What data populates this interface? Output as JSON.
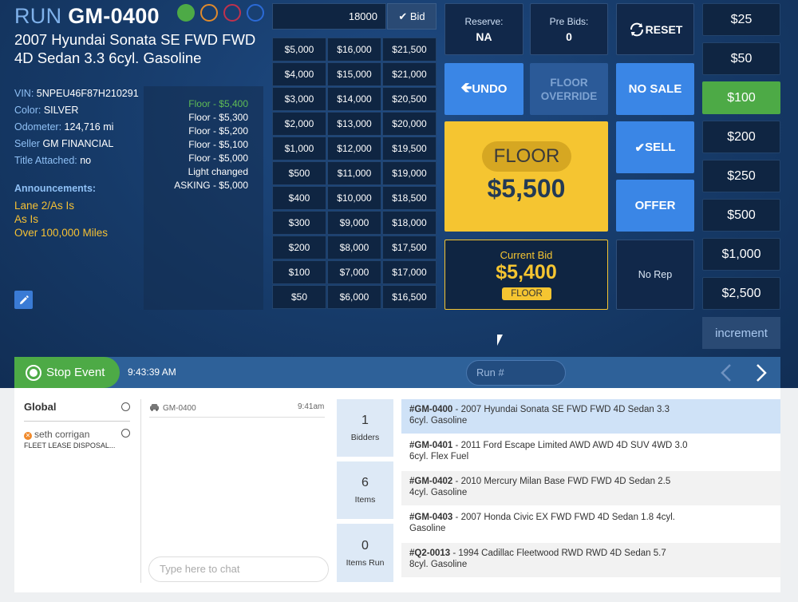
{
  "header": {
    "run_prefix": "RUN",
    "run_number": "GM-0400",
    "status_circles": [
      "#4daa46",
      "#e08a2c",
      "#c0314d",
      "#2b6ad6"
    ],
    "vehicle_title": "2007 Hyundai Sonata SE FWD FWD 4D Sedan 3.3 6cyl. Gasoline"
  },
  "vehicle_info": {
    "vin_label": "VIN:",
    "vin": "5NPEU46F87H210291",
    "color_label": "Color:",
    "color": "SILVER",
    "odometer_label": "Odometer:",
    "odometer": "124,716 mi",
    "seller_label": "Seller",
    "seller": "GM FINANCIAL",
    "title_label": "Title Attached:",
    "title": "no"
  },
  "announcements": {
    "heading": "Announcements:",
    "items": [
      "Lane 2/As Is",
      "As Is",
      "Over 100,000 Miles"
    ]
  },
  "bid_log": [
    "Floor - $5,400",
    "Floor - $5,300",
    "Floor - $5,200",
    "Floor - $5,100",
    "Floor - $5,000",
    "Light changed",
    "ASKING - $5,000"
  ],
  "bid_entry": {
    "value": "18000",
    "button": "Bid"
  },
  "amounts": [
    "$5,000",
    "$16,000",
    "$21,500",
    "$4,000",
    "$15,000",
    "$21,000",
    "$3,000",
    "$14,000",
    "$20,500",
    "$2,000",
    "$13,000",
    "$20,000",
    "$1,000",
    "$12,000",
    "$19,500",
    "$500",
    "$11,000",
    "$19,000",
    "$400",
    "$10,000",
    "$18,500",
    "$300",
    "$9,000",
    "$18,000",
    "$200",
    "$8,000",
    "$17,500",
    "$100",
    "$7,000",
    "$17,000",
    "$50",
    "$6,000",
    "$16,500"
  ],
  "controls": {
    "reserve_label": "Reserve:",
    "reserve_value": "NA",
    "prebids_label": "Pre Bids:",
    "prebids_value": "0",
    "reset": "RESET",
    "undo": "UNDO",
    "floor_override_1": "FLOOR",
    "floor_override_2": "OVERRIDE",
    "no_sale": "NO SALE",
    "sell": "SELL",
    "offer": "OFFER",
    "no_rep": "No Rep"
  },
  "floor": {
    "label": "FLOOR",
    "value": "$5,500"
  },
  "current_bid": {
    "label": "Current Bid",
    "value": "$5,400",
    "badge": "FLOOR"
  },
  "increments": [
    "$25",
    "$50",
    "$100",
    "$200",
    "$250",
    "$500",
    "$1,000",
    "$2,500"
  ],
  "active_increment": "$100",
  "increment_label": "increment",
  "status_bar": {
    "stop_event": "Stop Event",
    "time": "9:43:39 AM",
    "run_placeholder": "Run #"
  },
  "chat": {
    "global_label": "Global",
    "user_name": "seth corrigan",
    "user_company": "FLEET LEASE DISPOSAL...",
    "item_run": "GM-0400",
    "item_time": "9:41am",
    "placeholder": "Type here to chat"
  },
  "stats": [
    {
      "value": "1",
      "label": "Bidders"
    },
    {
      "value": "6",
      "label": "Items"
    },
    {
      "value": "0",
      "label": "Items Run"
    }
  ],
  "lots": [
    {
      "id": "#GM-0400",
      "desc": " - 2007 Hyundai Sonata SE FWD FWD 4D Sedan 3.3",
      "desc2": "6cyl. Gasoline"
    },
    {
      "id": "#GM-0401",
      "desc": " - 2011 Ford Escape Limited AWD AWD 4D SUV 4WD 3.0",
      "desc2": "6cyl. Flex Fuel"
    },
    {
      "id": "#GM-0402",
      "desc": " - 2010 Mercury Milan Base FWD FWD 4D Sedan 2.5",
      "desc2": "4cyl. Gasoline"
    },
    {
      "id": "#GM-0403",
      "desc": " - 2007 Honda Civic EX FWD FWD 4D Sedan 1.8 4cyl.",
      "desc2": "Gasoline"
    },
    {
      "id": "#Q2-0013",
      "desc": " - 1994 Cadillac Fleetwood RWD RWD 4D Sedan 5.7",
      "desc2": "8cyl. Gasoline"
    }
  ]
}
